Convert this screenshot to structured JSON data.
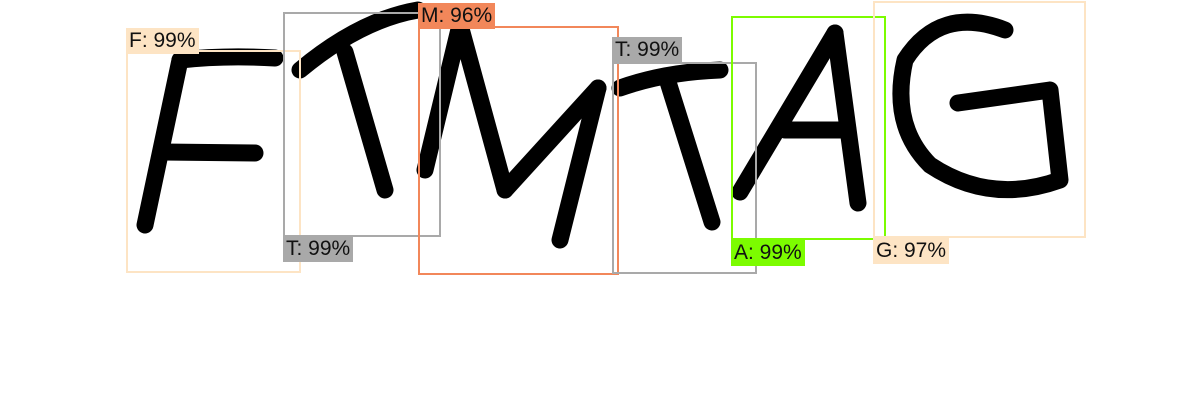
{
  "detections": [
    {
      "char": "F",
      "label": "F: 99%",
      "color": "#fde4c4"
    },
    {
      "char": "T",
      "label": "T: 99%",
      "color": "#a9a9a9"
    },
    {
      "char": "M",
      "label": "M: 96%",
      "color": "#f2875a"
    },
    {
      "char": "T",
      "label": "T: 99%",
      "color": "#a9a9a9"
    },
    {
      "char": "A",
      "label": "A: 99%",
      "color": "#7cfc00"
    },
    {
      "char": "G",
      "label": "G: 97%",
      "color": "#fde4c4"
    }
  ],
  "glyph_color": "#000000"
}
